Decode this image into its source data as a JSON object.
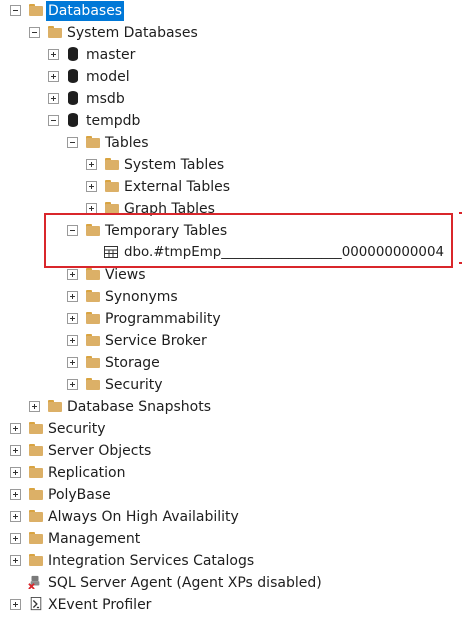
{
  "tree": {
    "databases": "Databases",
    "system_databases": "System Databases",
    "master": "master",
    "model": "model",
    "msdb": "msdb",
    "tempdb": "tempdb",
    "tables": "Tables",
    "system_tables": "System Tables",
    "external_tables": "External Tables",
    "graph_tables": "Graph Tables",
    "temporary_tables": "Temporary Tables",
    "temp_table_item": "dbo.#tmpEmp__________________000000000004",
    "views": "Views",
    "synonyms": "Synonyms",
    "programmability": "Programmability",
    "service_broker": "Service Broker",
    "storage": "Storage",
    "security_db": "Security",
    "database_snapshots": "Database Snapshots",
    "security": "Security",
    "server_objects": "Server Objects",
    "replication": "Replication",
    "polybase": "PolyBase",
    "always_on": "Always On High Availability",
    "management": "Management",
    "integration_services": "Integration Services Catalogs",
    "sql_agent": "SQL Server Agent (Agent XPs disabled)",
    "xevent_profiler": "XEvent Profiler"
  },
  "colors": {
    "selection": "#0078d7",
    "highlight_border": "#d9262b",
    "folder": "#dcb067"
  },
  "icons": {
    "folder": "folder-icon",
    "database": "database-icon",
    "table": "table-icon",
    "agent": "sql-agent-icon",
    "xevent": "xevent-icon"
  }
}
